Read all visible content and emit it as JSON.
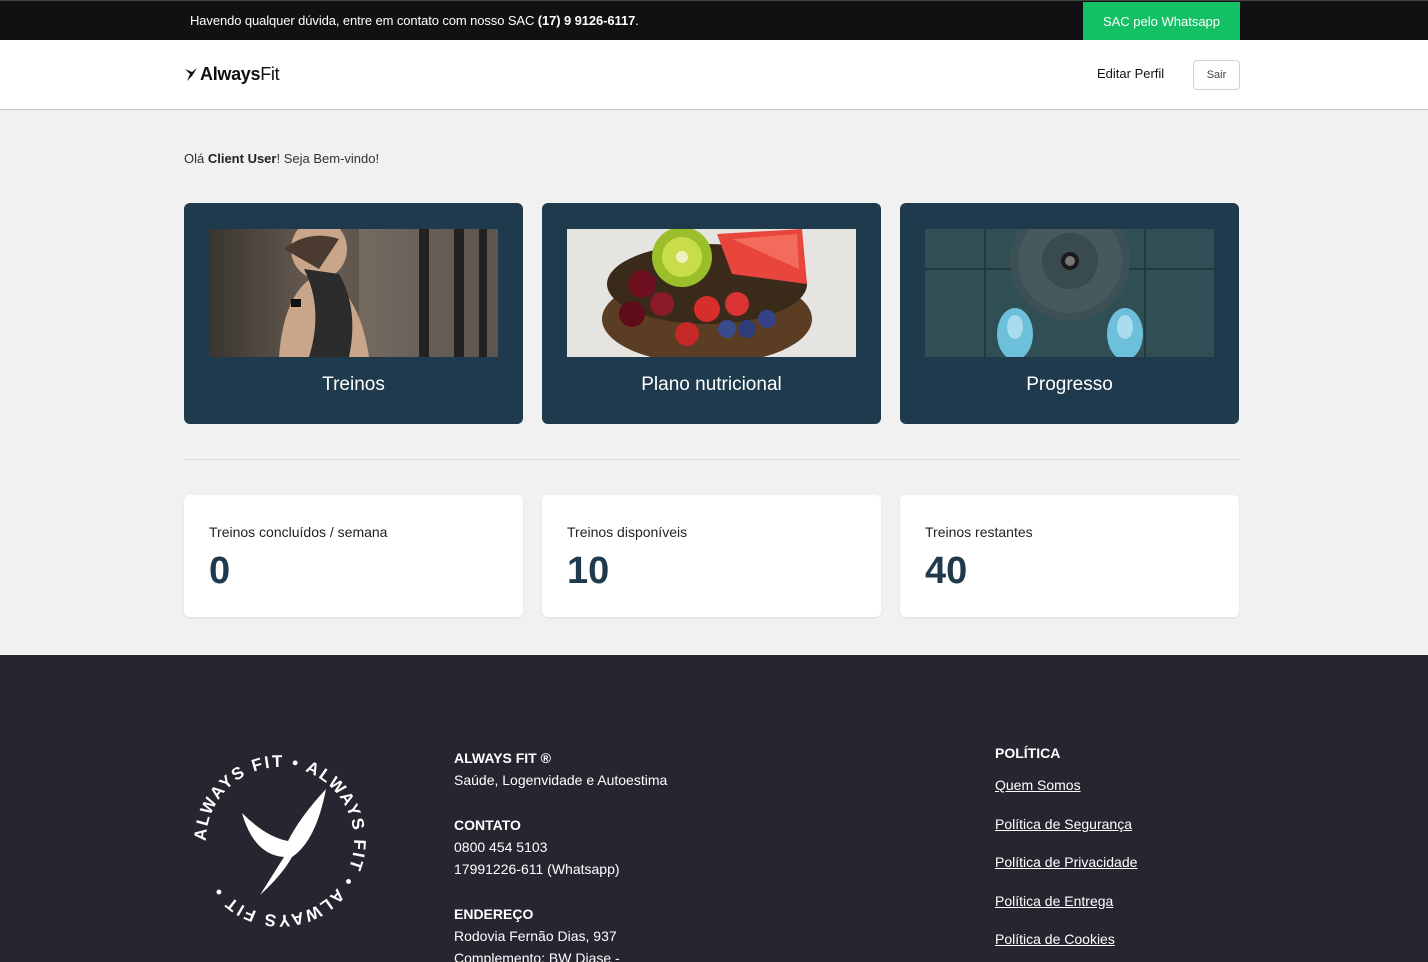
{
  "topbar": {
    "message_prefix": "Havendo qualquer dúvida, entre em contato com nosso SAC ",
    "phone": "(17) 9 9126-6117",
    "message_suffix": ".",
    "whatsapp_button": "SAC pelo Whatsapp"
  },
  "header": {
    "logo_bold": "Always",
    "logo_light": "Fit",
    "edit_profile": "Editar Perfil",
    "logout": "Sair"
  },
  "greeting": {
    "prefix": "Olá ",
    "user": "Client User",
    "suffix": "! Seja Bem-vindo!"
  },
  "cards": [
    {
      "label": "Treinos",
      "image": "woman-training-photo"
    },
    {
      "label": "Plano nutricional",
      "image": "fruit-bowl-photo"
    },
    {
      "label": "Progresso",
      "image": "weight-plate-sneakers-photo"
    }
  ],
  "stats": [
    {
      "title": "Treinos concluídos / semana",
      "value": "0"
    },
    {
      "title": "Treinos disponíveis",
      "value": "10"
    },
    {
      "title": "Treinos restantes",
      "value": "40"
    }
  ],
  "footer": {
    "seal_text": "ALWAYS FIT • ALWAYS FIT • ALWAYS FIT •",
    "brand_title": "ALWAYS FIT ®",
    "brand_tagline": "Saúde, Logenvidade e Autoestima",
    "contact_title": "CONTATO",
    "contact_phone": "0800 454 5103",
    "contact_whatsapp": "17991226-611 (Whatsapp)",
    "address_title": "ENDEREÇO",
    "address_line1": "Rodovia Fernão Dias, 937",
    "address_line2": "Complemento: BW Diase -",
    "policy_title": "POLÍTICA",
    "policy_links": [
      "Quem Somos",
      "Política de Segurança",
      "Política de Privacidade",
      "Política de Entrega",
      "Política de Cookies"
    ]
  },
  "colors": {
    "primary": "#1f3a4d",
    "whatsapp_green": "#14c064",
    "topbar_bg": "#111114",
    "footer_bg": "#262630",
    "page_bg": "#f1f1f2"
  }
}
